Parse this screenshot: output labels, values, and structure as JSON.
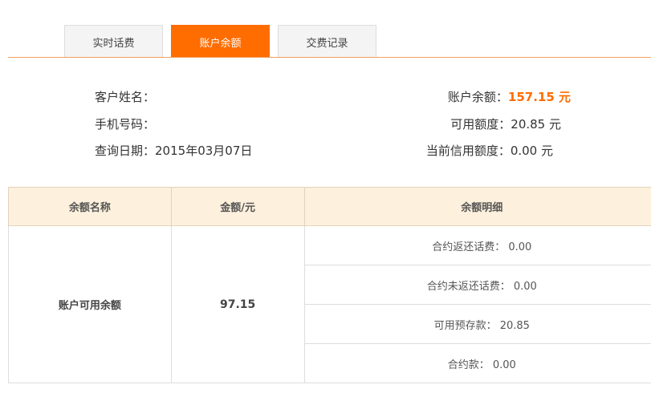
{
  "tabs": [
    {
      "label": "实时话费",
      "active": false
    },
    {
      "label": "账户余额",
      "active": true
    },
    {
      "label": "交费记录",
      "active": false
    }
  ],
  "customer": {
    "name_label": "客户姓名：",
    "name_value": "",
    "phone_label": "手机号码：",
    "phone_value": "",
    "query_date_label": "查询日期：",
    "query_date_value": "2015年03月07日"
  },
  "balance": {
    "account_balance_label": "账户余额：",
    "account_balance_value": "157.15 元",
    "available_label": "可用额度：",
    "available_value": "20.85 元",
    "credit_label": "当前信用额度：",
    "credit_value": "0.00 元"
  },
  "table": {
    "headers": [
      "余额名称",
      "金额/元",
      "余额明细"
    ],
    "row": {
      "name": "账户可用余额",
      "amount": "97.15",
      "details": [
        "合约返还话费： 0.00",
        "合约未返还话费： 0.00",
        "可用预存款： 20.85",
        "合约款： 0.00"
      ]
    }
  },
  "colors": {
    "accent": "#ff6c00",
    "header_bg": "#fdf0dc"
  }
}
